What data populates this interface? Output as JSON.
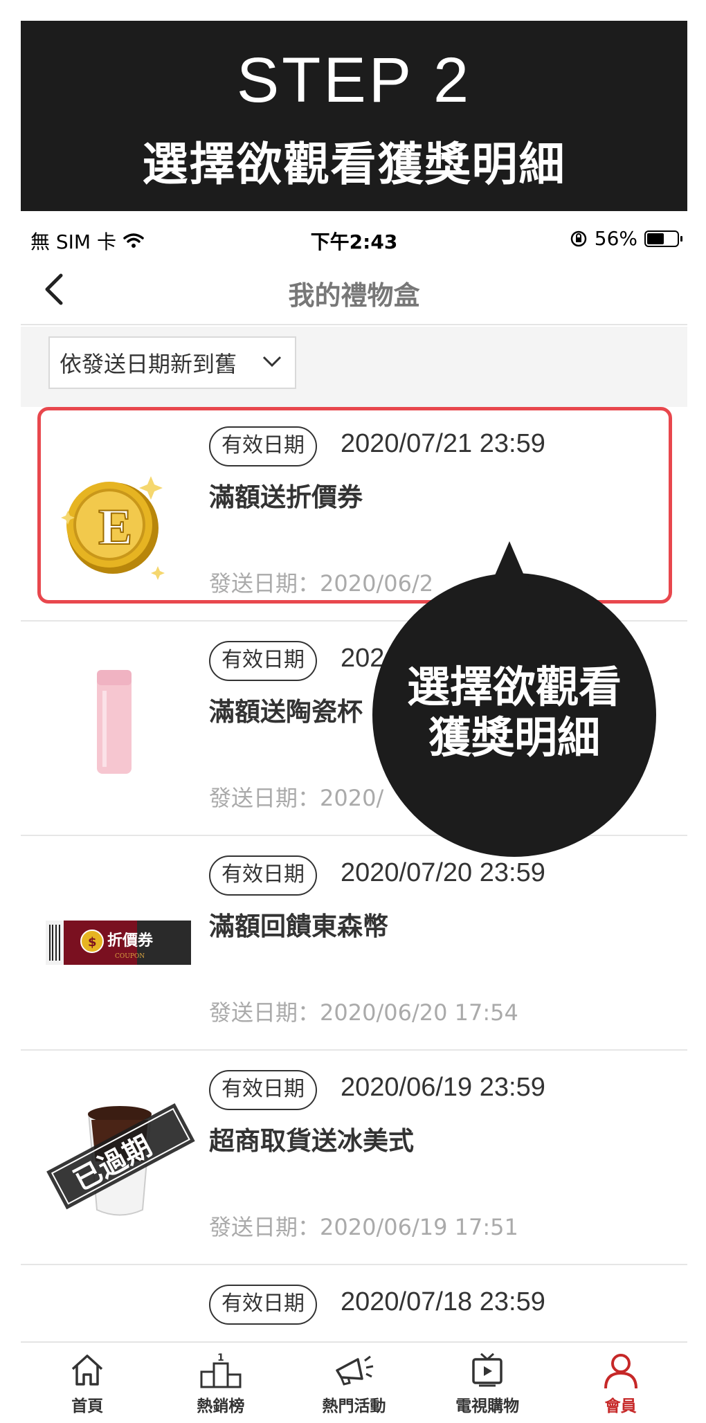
{
  "banner": {
    "step": "STEP 2",
    "subtitle": "選擇欲觀看獲獎明細"
  },
  "status_bar": {
    "carrier": "無 SIM 卡",
    "time": "下午2:43",
    "battery": "56%",
    "battery_level": 0.56
  },
  "nav": {
    "title": "我的禮物盒"
  },
  "filter": {
    "sort_value": "依發送日期新到舊"
  },
  "items": [
    {
      "valid_label": "有效日期",
      "expiry": "2020/07/21 23:59",
      "name": "滿額送折價券",
      "sent": "發送日期：2020/06/2",
      "thumb": "gold-coin-icon"
    },
    {
      "valid_label": "有效日期",
      "expiry": "202",
      "name": "滿額送陶瓷杯",
      "sent": "發送日期：2020/",
      "thumb": "pink-bottle-image"
    },
    {
      "valid_label": "有效日期",
      "expiry": "2020/07/20 23:59",
      "name": "滿額回饋東森幣",
      "sent": "發送日期：2020/06/20 17:54",
      "thumb": "coupon-ticket-image",
      "thumb_text": "折價券",
      "thumb_sub": "COUPON"
    },
    {
      "valid_label": "有效日期",
      "expiry": "2020/06/19 23:59",
      "name": "超商取貨送冰美式",
      "sent": "發送日期：2020/06/19 17:51",
      "thumb": "iced-coffee-expired-image",
      "stamp": "已過期"
    },
    {
      "valid_label": "有效日期",
      "expiry": "2020/07/18 23:59"
    }
  ],
  "callout": {
    "line1": "選擇欲觀看",
    "line2": "獲獎明細"
  },
  "tabbar": {
    "tabs": [
      {
        "label": "首頁",
        "icon": "home-icon"
      },
      {
        "label": "熱銷榜",
        "icon": "podium-icon",
        "badge": "1"
      },
      {
        "label": "熱門活動",
        "icon": "megaphone-icon"
      },
      {
        "label": "電視購物",
        "icon": "tv-icon"
      },
      {
        "label": "會員",
        "icon": "user-icon"
      }
    ],
    "active_color": "#c62828"
  },
  "colors": {
    "banner_bg": "#1c1c1c",
    "highlight": "#e8474d"
  }
}
